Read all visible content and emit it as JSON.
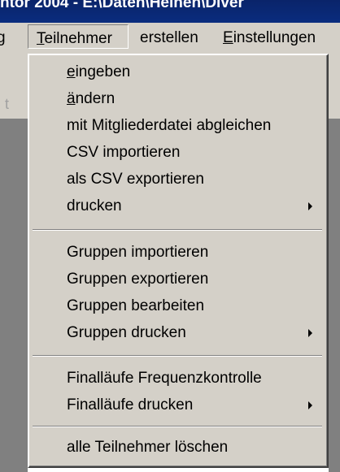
{
  "window": {
    "title": "ntor 2004 - E:\\Daten\\Heinen\\Diver"
  },
  "menubar": {
    "items": [
      {
        "label": "g"
      },
      {
        "label": "Teilnehmer",
        "accel": "T",
        "rest": "eilnehmer"
      },
      {
        "label": "erstellen"
      },
      {
        "label": "Einstellungen",
        "accel": "E",
        "rest": "instellungen"
      }
    ]
  },
  "toolbar": {
    "fragment": "t"
  },
  "menu": {
    "groups": [
      [
        {
          "accel": "e",
          "rest": "ingeben",
          "label": "eingeben",
          "submenu": false
        },
        {
          "accel": "ä",
          "rest": "ndern",
          "label": "ändern",
          "submenu": false
        },
        {
          "label": "mit Mitgliederdatei abgleichen",
          "submenu": false
        },
        {
          "label": "CSV importieren",
          "submenu": false
        },
        {
          "label": "als CSV exportieren",
          "submenu": false
        },
        {
          "label": "drucken",
          "submenu": true
        }
      ],
      [
        {
          "label": "Gruppen importieren",
          "submenu": false
        },
        {
          "label": "Gruppen exportieren",
          "submenu": false
        },
        {
          "label": "Gruppen bearbeiten",
          "submenu": false
        },
        {
          "label": "Gruppen drucken",
          "submenu": true
        }
      ],
      [
        {
          "label": "Finalläufe Frequenzkontrolle",
          "submenu": false
        },
        {
          "label": "Finalläufe drucken",
          "submenu": true
        }
      ],
      [
        {
          "label": "alle Teilnehmer löschen",
          "submenu": false
        }
      ]
    ]
  },
  "colors": {
    "titlebar": "#0a246a",
    "menu_bg": "#d4d0c8",
    "workspace": "#808080"
  }
}
